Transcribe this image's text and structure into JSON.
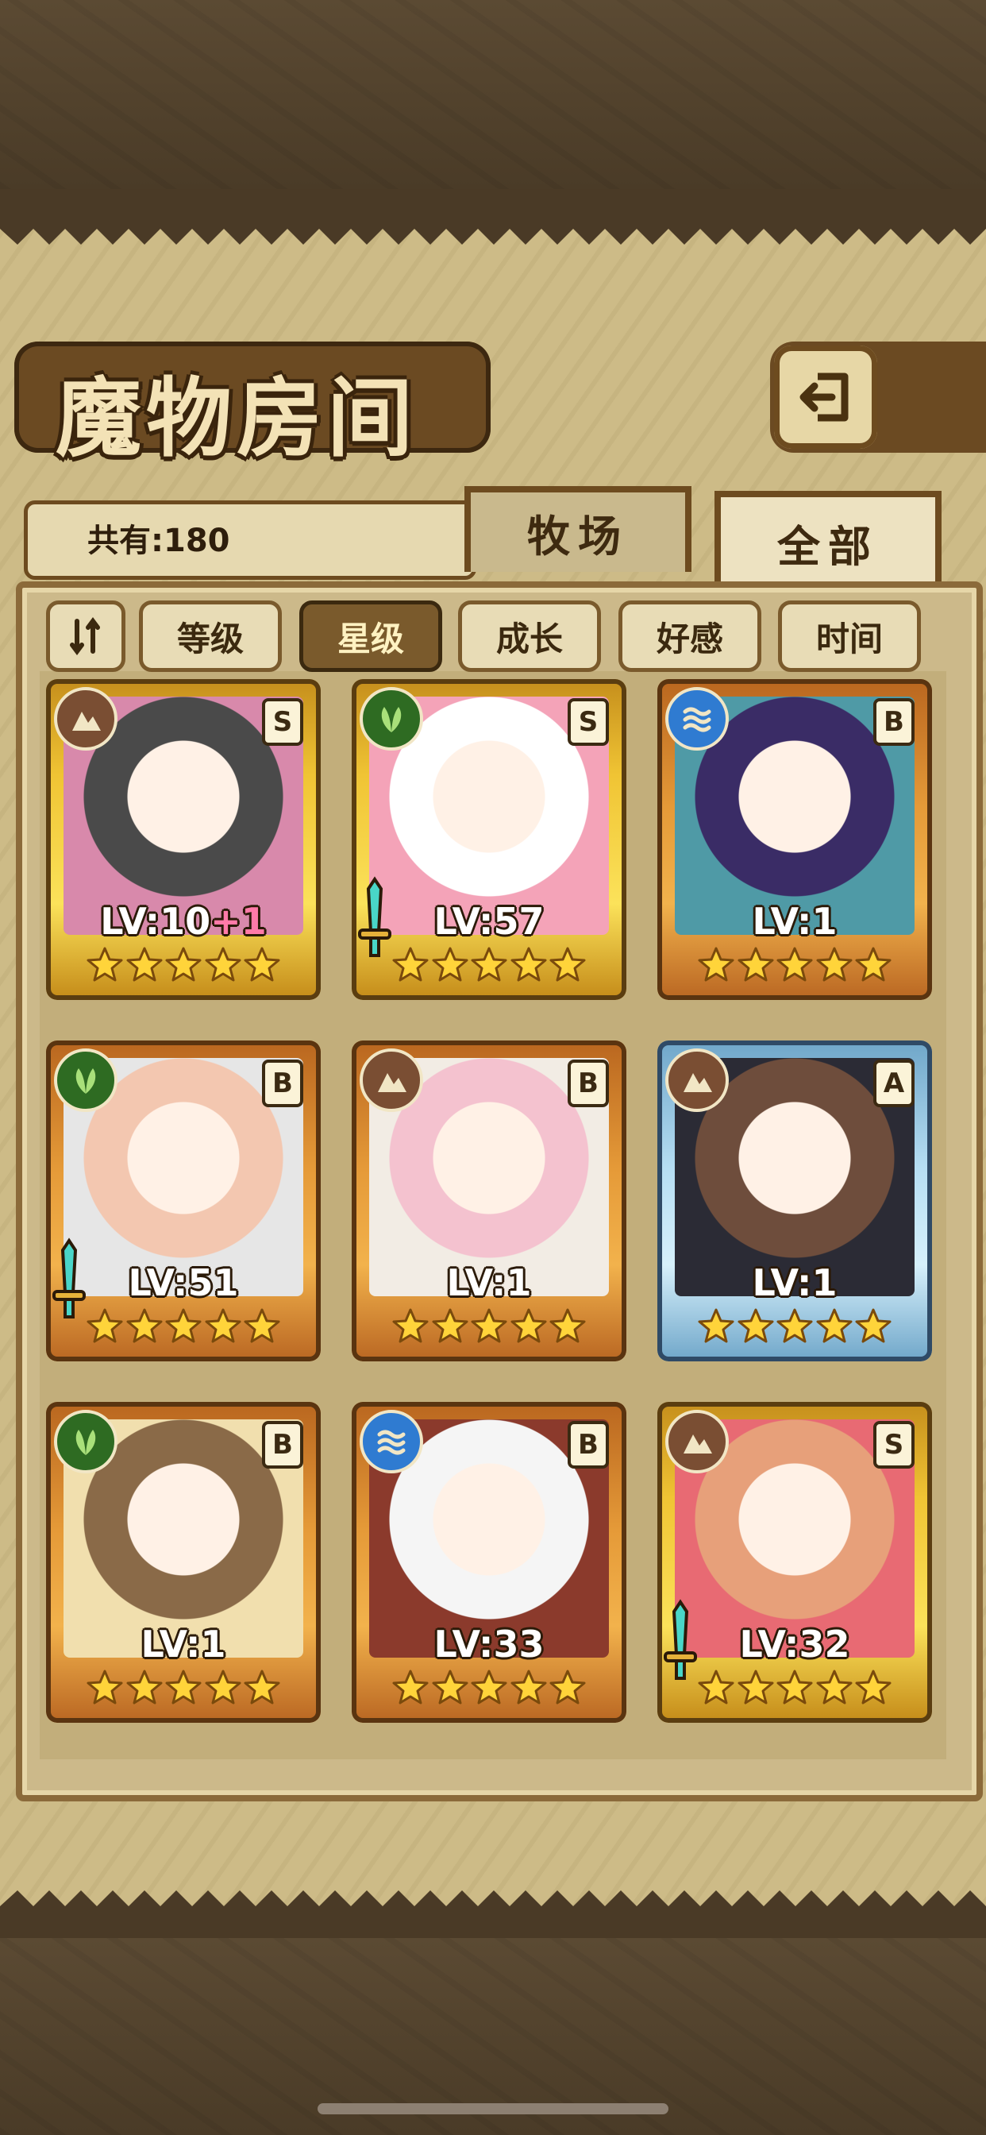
{
  "header": {
    "title": "魔物房间"
  },
  "inventory": {
    "count_text": "共有:180"
  },
  "tabs": [
    {
      "label": "牧场",
      "active": false
    },
    {
      "label": "全部",
      "active": true
    }
  ],
  "sort": {
    "toggle_label": "⇂⇃",
    "options": [
      {
        "label": "等级",
        "active": false
      },
      {
        "label": "星级",
        "active": true
      },
      {
        "label": "成长",
        "active": false
      },
      {
        "label": "好感",
        "active": false
      },
      {
        "label": "时间",
        "active": false
      }
    ]
  },
  "colors": {
    "earth": "#7a4e33",
    "leaf": "#2e6b22",
    "water": "#2f7bd1",
    "gold_frame": "#f0c434",
    "orange_frame": "#e59a38",
    "blue_frame": "#b6def3"
  },
  "monsters": [
    {
      "element": "earth-icon",
      "rank": "S",
      "level_text": "LV:10",
      "bonus": "+1",
      "stars": 5,
      "frame": "gold",
      "weapon": false
    },
    {
      "element": "leaf-icon",
      "rank": "S",
      "level_text": "LV:57",
      "bonus": "",
      "stars": 5,
      "frame": "gold",
      "weapon": true
    },
    {
      "element": "water-icon",
      "rank": "B",
      "level_text": "LV:1",
      "bonus": "",
      "stars": 5,
      "frame": "orange",
      "weapon": false
    },
    {
      "element": "leaf-icon",
      "rank": "B",
      "level_text": "LV:51",
      "bonus": "",
      "stars": 5,
      "frame": "orange",
      "weapon": true
    },
    {
      "element": "earth-icon",
      "rank": "B",
      "level_text": "LV:1",
      "bonus": "",
      "stars": 5,
      "frame": "orange",
      "weapon": false
    },
    {
      "element": "earth-icon",
      "rank": "A",
      "level_text": "LV:1",
      "bonus": "",
      "stars": 5,
      "frame": "blue",
      "weapon": false
    },
    {
      "element": "leaf-icon",
      "rank": "B",
      "level_text": "LV:1",
      "bonus": "",
      "stars": 5,
      "frame": "orange",
      "weapon": false
    },
    {
      "element": "water-icon",
      "rank": "B",
      "level_text": "LV:33",
      "bonus": "",
      "stars": 5,
      "frame": "orange",
      "weapon": false
    },
    {
      "element": "earth-icon",
      "rank": "S",
      "level_text": "LV:32",
      "bonus": "",
      "stars": 5,
      "frame": "gold",
      "weapon": true
    }
  ]
}
